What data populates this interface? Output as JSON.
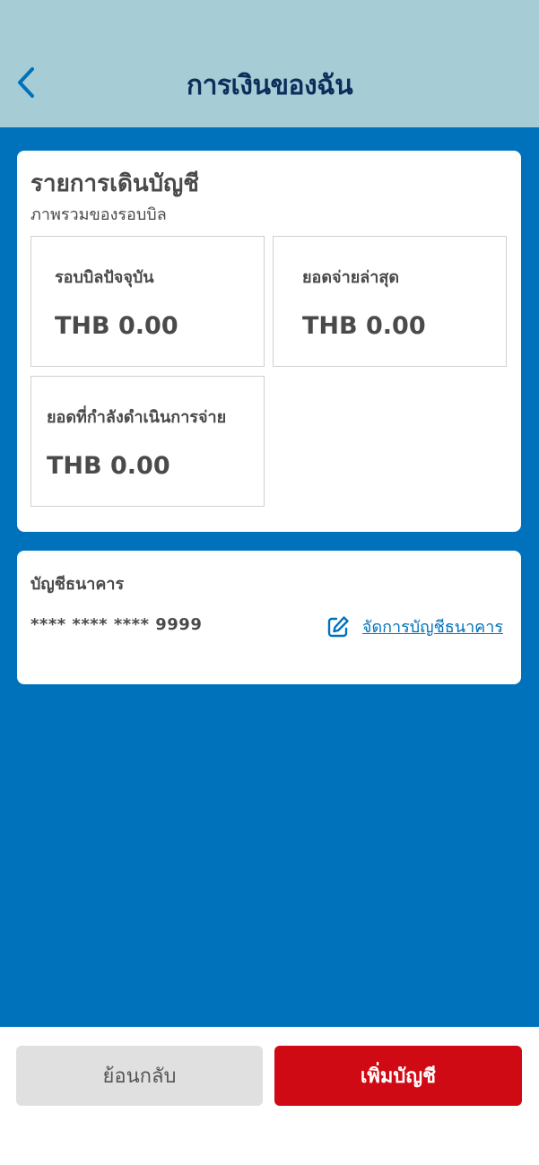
{
  "header": {
    "title": "การเงินของฉัน",
    "back_icon": "chevron-left-icon"
  },
  "summary_card": {
    "title": "รายการเดินบัญชี",
    "subtitle": "ภาพรวมของรอบบิล",
    "boxes": [
      {
        "label": "รอบบิลปัจจุบัน",
        "value": "THB 0.00"
      },
      {
        "label": "ยอดจ่ายล่าสุด",
        "value": "THB 0.00"
      },
      {
        "label": "ยอดที่กำลังดำเนินการจ่าย",
        "value": "THB 0.00"
      }
    ]
  },
  "bank_card": {
    "title": "บัญชีธนาคาร",
    "account_number": "**** **** **** 9999",
    "manage_label": "จัดการบัญชีธนาคาร",
    "manage_icon": "edit-icon"
  },
  "footer": {
    "back_label": "ย้อนกลับ",
    "add_label": "เพิ่มบัญชี"
  },
  "colors": {
    "header_bg": "#a6ccd6",
    "title": "#0b2d5a",
    "main_bg": "#0072bb",
    "text": "#4a4a4a",
    "link": "#0072bb",
    "primary_button": "#cf0a14",
    "secondary_button": "#e0e0e0"
  }
}
